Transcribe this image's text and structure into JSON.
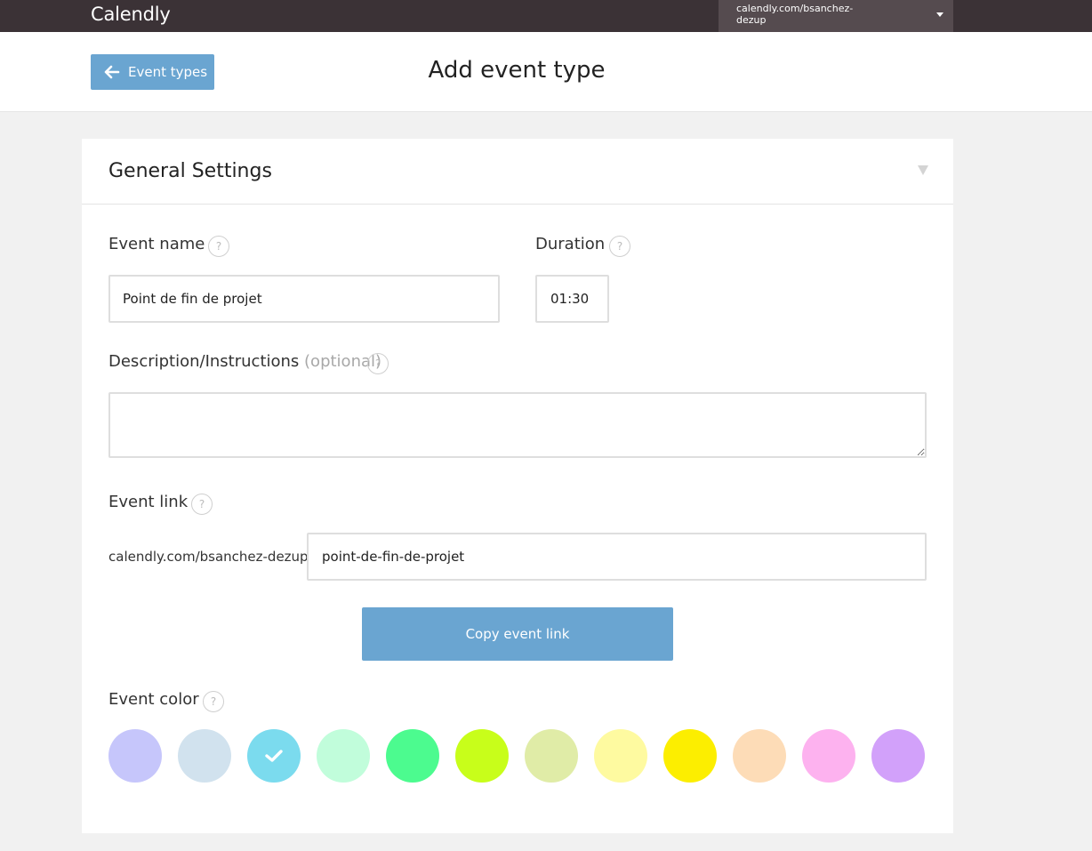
{
  "app": {
    "brand": "Calendly",
    "account_label": "calendly.com/bsanchez-dezup"
  },
  "header": {
    "back_label": "Event types",
    "title": "Add event type"
  },
  "general_settings": {
    "title": "General Settings",
    "event_name": {
      "label": "Event name",
      "value": "Point de fin de projet"
    },
    "duration": {
      "label": "Duration",
      "value": "01:30"
    },
    "description": {
      "label": "Description/Instructions",
      "optional_label": "(optional)",
      "value": ""
    },
    "event_link": {
      "label": "Event link",
      "prefix": "calendly.com/bsanchez-dezup/",
      "slug": "point-de-fin-de-projet"
    },
    "copy_button": "Copy event link",
    "event_color": {
      "label": "Event color",
      "selected_index": 2,
      "options": [
        "#c6c6fb",
        "#d1e2ee",
        "#7bdbee",
        "#c1fddb",
        "#4cfb8f",
        "#c8fe1a",
        "#e0eca7",
        "#fefaa0",
        "#fcee00",
        "#fddcb7",
        "#fdb2ef",
        "#d2a1fa"
      ]
    }
  },
  "help_glyph": "?"
}
